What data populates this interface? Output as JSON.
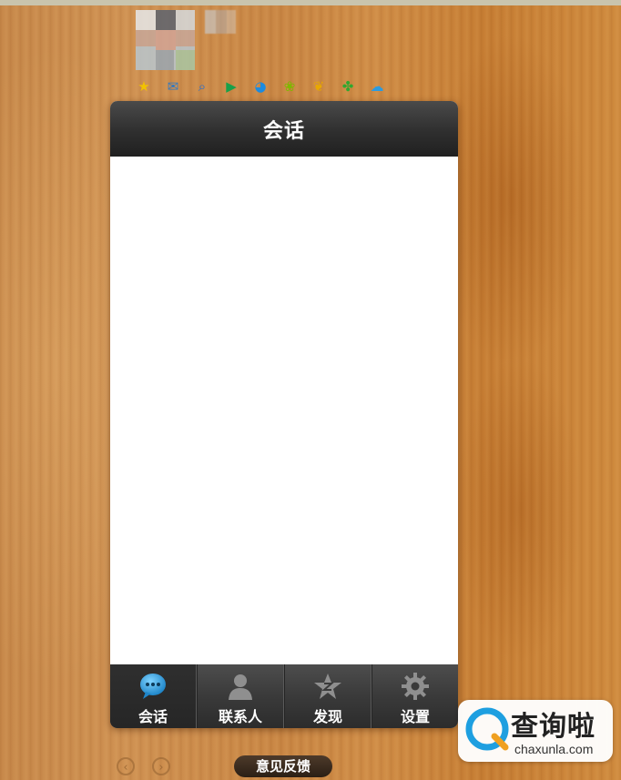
{
  "header": {
    "title": "会话"
  },
  "app_icons": [
    {
      "name": "star-icon",
      "glyph": "★"
    },
    {
      "name": "mail-icon",
      "glyph": "✉"
    },
    {
      "name": "search-icon",
      "glyph": "⌕"
    },
    {
      "name": "play-icon",
      "glyph": "▶"
    },
    {
      "name": "ball-icon",
      "glyph": "◕"
    },
    {
      "name": "fruit-icon",
      "glyph": "❀"
    },
    {
      "name": "moneybag-icon",
      "glyph": "❦"
    },
    {
      "name": "clover-icon",
      "glyph": "✤"
    },
    {
      "name": "cloud-icon",
      "glyph": "☁"
    }
  ],
  "tabs": [
    {
      "label": "会话",
      "icon": "chat-bubble-icon",
      "active": true
    },
    {
      "label": "联系人",
      "icon": "contacts-icon",
      "active": false
    },
    {
      "label": "发现",
      "icon": "discover-star-icon",
      "active": false
    },
    {
      "label": "设置",
      "icon": "settings-gear-icon",
      "active": false
    }
  ],
  "footer": {
    "prev_glyph": "‹",
    "next_glyph": "›",
    "feedback_label": "意见反馈"
  },
  "watermark": {
    "title": "查询啦",
    "url": "chaxunla.com"
  },
  "colors": {
    "accent_blue": "#2a9fd8",
    "titlebar_dark": "#2f2f2f",
    "wood": "#cb8a47"
  }
}
